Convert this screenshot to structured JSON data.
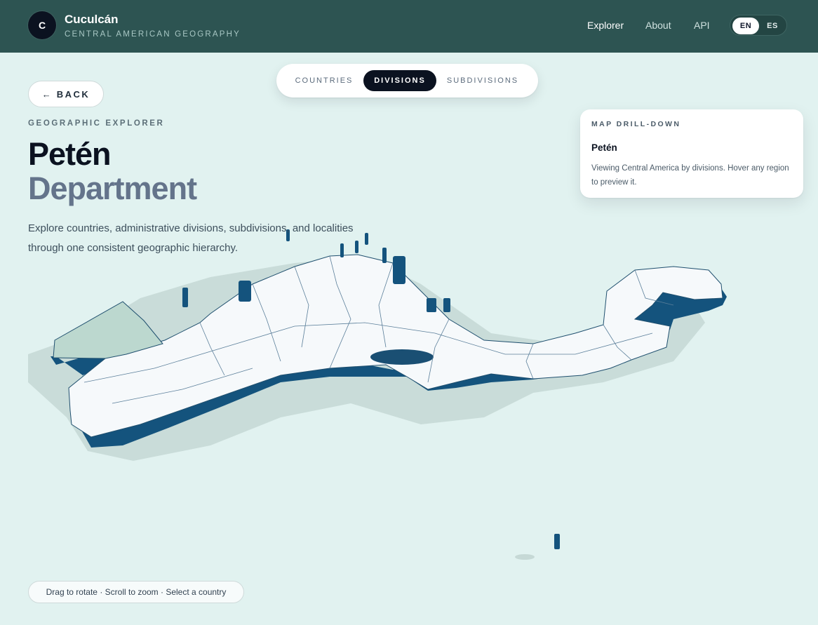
{
  "header": {
    "logo_letter": "C",
    "brand_name": "Cuculcán",
    "brand_tagline": "CENTRAL AMERICAN GEOGRAPHY",
    "nav": [
      {
        "label": "Explorer",
        "active": true
      },
      {
        "label": "About",
        "active": false
      },
      {
        "label": "API",
        "active": false
      }
    ],
    "languages": [
      {
        "label": "EN",
        "active": true
      },
      {
        "label": "ES",
        "active": false
      }
    ]
  },
  "level_switch": {
    "items": [
      "COUNTRIES",
      "DIVISIONS",
      "SUBDIVISIONS"
    ],
    "selected": "DIVISIONS"
  },
  "back_label": "BACK",
  "hero": {
    "eyebrow": "GEOGRAPHIC EXPLORER",
    "title": "Petén",
    "subtitle": "Department",
    "description": "Explore countries, administrative divisions, subdivisions, and localities through one consistent geographic hierarchy."
  },
  "drilldown_card": {
    "eyebrow": "MAP DRILL-DOWN",
    "title": "Petén",
    "text": "Viewing Central America by divisions. Hover any region to preview it."
  },
  "map_hint": "Drag to rotate · Scroll to zoom · Select a country",
  "colors": {
    "header_bg": "#2d5452",
    "page_bg": "#e1f2f0",
    "land_top": "#f6f9fb",
    "land_side": "#14537d",
    "selected_region": "#bcd8cf",
    "accent_dark": "#0b1220"
  }
}
